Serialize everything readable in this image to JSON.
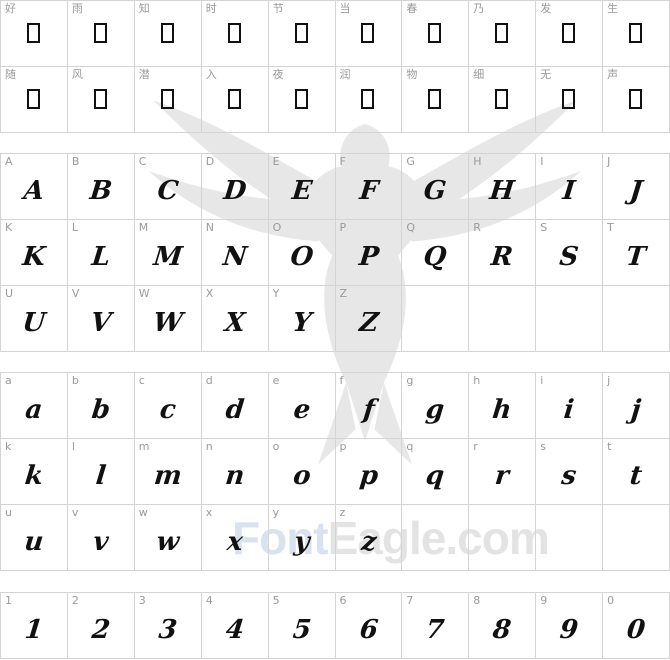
{
  "sections": [
    {
      "id": "chinese",
      "kind": "tofu",
      "cells": [
        {
          "label": "好"
        },
        {
          "label": "雨"
        },
        {
          "label": "知"
        },
        {
          "label": "时"
        },
        {
          "label": "节"
        },
        {
          "label": "当"
        },
        {
          "label": "春"
        },
        {
          "label": "乃"
        },
        {
          "label": "发"
        },
        {
          "label": "生"
        },
        {
          "label": "随"
        },
        {
          "label": "风"
        },
        {
          "label": "潜"
        },
        {
          "label": "入"
        },
        {
          "label": "夜"
        },
        {
          "label": "润"
        },
        {
          "label": "物"
        },
        {
          "label": "细"
        },
        {
          "label": "无"
        },
        {
          "label": "声"
        }
      ]
    },
    {
      "id": "uppercase",
      "kind": "glyph",
      "cells": [
        {
          "label": "A",
          "glyph": "A"
        },
        {
          "label": "B",
          "glyph": "B"
        },
        {
          "label": "C",
          "glyph": "C"
        },
        {
          "label": "D",
          "glyph": "D"
        },
        {
          "label": "E",
          "glyph": "E"
        },
        {
          "label": "F",
          "glyph": "F"
        },
        {
          "label": "G",
          "glyph": "G"
        },
        {
          "label": "H",
          "glyph": "H"
        },
        {
          "label": "I",
          "glyph": "I"
        },
        {
          "label": "J",
          "glyph": "J"
        },
        {
          "label": "K",
          "glyph": "K"
        },
        {
          "label": "L",
          "glyph": "L"
        },
        {
          "label": "M",
          "glyph": "M"
        },
        {
          "label": "N",
          "glyph": "N"
        },
        {
          "label": "O",
          "glyph": "O"
        },
        {
          "label": "P",
          "glyph": "P"
        },
        {
          "label": "Q",
          "glyph": "Q"
        },
        {
          "label": "R",
          "glyph": "R"
        },
        {
          "label": "S",
          "glyph": "S"
        },
        {
          "label": "T",
          "glyph": "T"
        },
        {
          "label": "U",
          "glyph": "U"
        },
        {
          "label": "V",
          "glyph": "V"
        },
        {
          "label": "W",
          "glyph": "W"
        },
        {
          "label": "X",
          "glyph": "X"
        },
        {
          "label": "Y",
          "glyph": "Y"
        },
        {
          "label": "Z",
          "glyph": "Z"
        }
      ]
    },
    {
      "id": "lowercase",
      "kind": "glyph",
      "cells": [
        {
          "label": "a",
          "glyph": "a"
        },
        {
          "label": "b",
          "glyph": "b"
        },
        {
          "label": "c",
          "glyph": "c"
        },
        {
          "label": "d",
          "glyph": "d"
        },
        {
          "label": "e",
          "glyph": "e"
        },
        {
          "label": "f",
          "glyph": "f"
        },
        {
          "label": "g",
          "glyph": "g"
        },
        {
          "label": "h",
          "glyph": "h"
        },
        {
          "label": "i",
          "glyph": "i"
        },
        {
          "label": "j",
          "glyph": "j"
        },
        {
          "label": "k",
          "glyph": "k"
        },
        {
          "label": "l",
          "glyph": "l"
        },
        {
          "label": "m",
          "glyph": "m"
        },
        {
          "label": "n",
          "glyph": "n"
        },
        {
          "label": "o",
          "glyph": "o"
        },
        {
          "label": "p",
          "glyph": "p"
        },
        {
          "label": "q",
          "glyph": "q"
        },
        {
          "label": "r",
          "glyph": "r"
        },
        {
          "label": "s",
          "glyph": "s"
        },
        {
          "label": "t",
          "glyph": "t"
        },
        {
          "label": "u",
          "glyph": "u"
        },
        {
          "label": "v",
          "glyph": "v"
        },
        {
          "label": "w",
          "glyph": "w"
        },
        {
          "label": "x",
          "glyph": "x"
        },
        {
          "label": "y",
          "glyph": "y"
        },
        {
          "label": "z",
          "glyph": "z"
        }
      ]
    },
    {
      "id": "digits",
      "kind": "glyph",
      "cells": [
        {
          "label": "1",
          "glyph": "1"
        },
        {
          "label": "2",
          "glyph": "2"
        },
        {
          "label": "3",
          "glyph": "3"
        },
        {
          "label": "4",
          "glyph": "4"
        },
        {
          "label": "5",
          "glyph": "5"
        },
        {
          "label": "6",
          "glyph": "6"
        },
        {
          "label": "7",
          "glyph": "7"
        },
        {
          "label": "8",
          "glyph": "8"
        },
        {
          "label": "9",
          "glyph": "9"
        },
        {
          "label": "0",
          "glyph": "0"
        }
      ]
    }
  ],
  "watermark": {
    "text_a": "Font",
    "text_b": "Eagle.com",
    "icon": "eagle-icon"
  },
  "colors": {
    "grid_line": "#d4d4d4",
    "label": "#9a9a9a",
    "glyph": "#111111"
  }
}
